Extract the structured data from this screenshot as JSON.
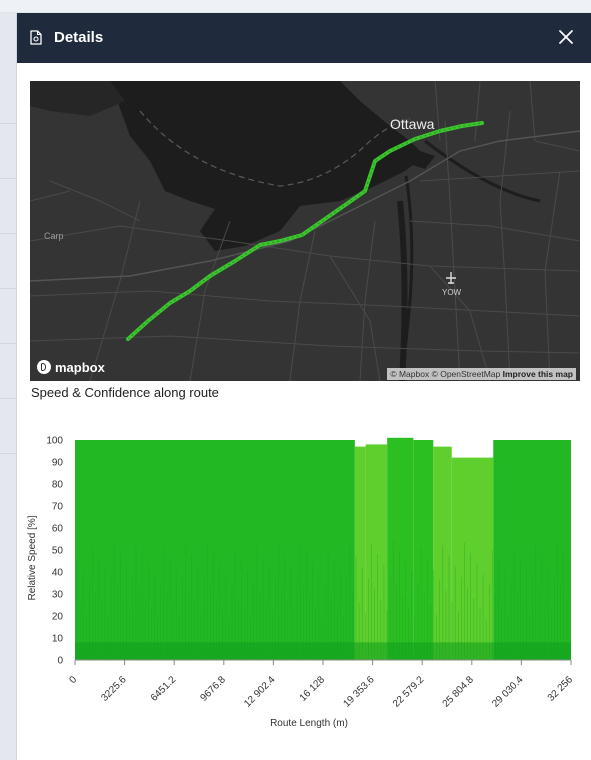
{
  "panel": {
    "title": "Details",
    "icon": "document-icon",
    "close_icon": "close-icon"
  },
  "map": {
    "city_label": "Ottawa",
    "place_carp": "Carp",
    "airport_code": "YOW",
    "logo_text": "mapbox",
    "attribution": {
      "mapbox": "© Mapbox",
      "osm": "© OpenStreetMap",
      "improve": "Improve this map"
    },
    "route_color": "#3cc42e"
  },
  "section_title": "Speed & Confidence along route",
  "chart_data": {
    "type": "area",
    "xlabel": "Route Length (m)",
    "ylabel": "Relative Speed [%]",
    "xlim": [
      0,
      32256
    ],
    "ylim": [
      0,
      100
    ],
    "yticks": [
      0,
      10,
      20,
      30,
      40,
      50,
      60,
      70,
      80,
      90,
      100
    ],
    "xticks": [
      "0",
      "3225.6",
      "6451.2",
      "9676.8",
      "12 902.4",
      "16 128",
      "19 353.6",
      "22 579.2",
      "25 804.8",
      "29 030.4",
      "32 256"
    ],
    "segments": [
      {
        "x0": 0,
        "x1": 18200,
        "y": 100,
        "color": "#22b824"
      },
      {
        "x0": 18200,
        "x1": 18900,
        "y": 97,
        "color": "#5fcf2d"
      },
      {
        "x0": 18900,
        "x1": 20300,
        "y": 98,
        "color": "#5fcf2d"
      },
      {
        "x0": 20300,
        "x1": 22000,
        "y": 101,
        "color": "#2cbf22"
      },
      {
        "x0": 22000,
        "x1": 23300,
        "y": 100,
        "color": "#2cbf22"
      },
      {
        "x0": 23300,
        "x1": 24500,
        "y": 97,
        "color": "#5fcf2d"
      },
      {
        "x0": 24500,
        "x1": 27200,
        "y": 92,
        "color": "#5fcf2d"
      },
      {
        "x0": 27200,
        "x1": 32256,
        "y": 100,
        "color": "#22b824"
      }
    ]
  }
}
